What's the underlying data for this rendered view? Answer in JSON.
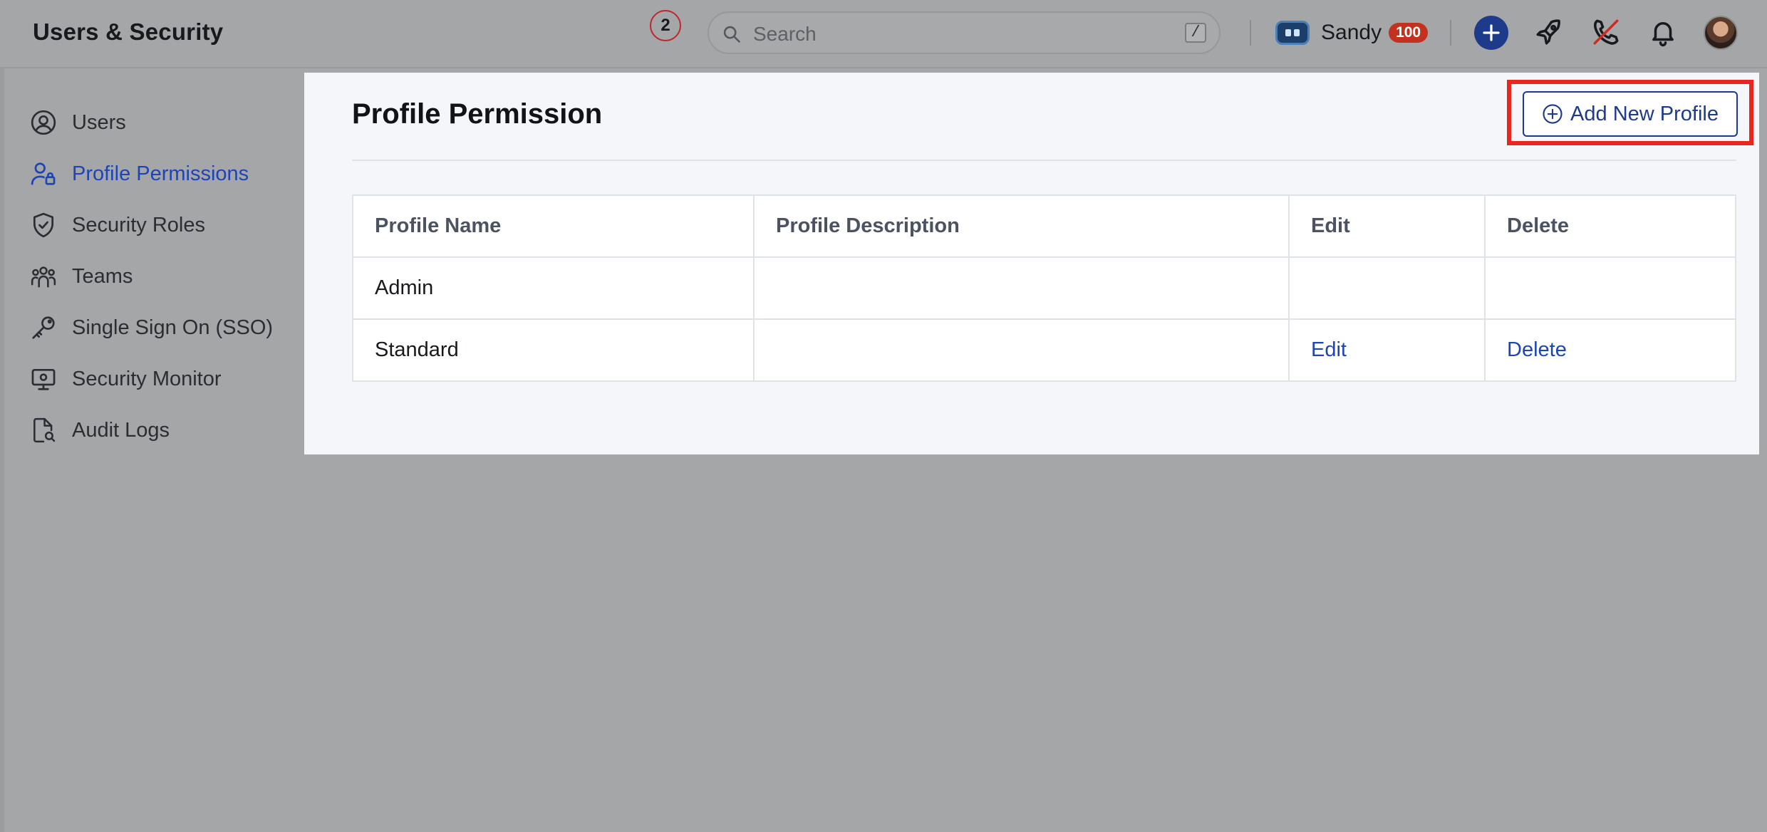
{
  "header": {
    "app_title": "Users & Security",
    "step_badge": "2",
    "search": {
      "placeholder": "Search",
      "value": "",
      "shortcut_key": "/"
    },
    "user": {
      "name": "Sandy",
      "credits": "100"
    },
    "icons": [
      "plus-icon",
      "rocket-icon",
      "phone-off-icon",
      "bell-icon",
      "avatar"
    ]
  },
  "sidebar": {
    "items": [
      {
        "label": "Users",
        "icon": "user-circle-icon",
        "active": false
      },
      {
        "label": "Profile Permissions",
        "icon": "user-lock-icon",
        "active": true
      },
      {
        "label": "Security Roles",
        "icon": "shield-check-icon",
        "active": false
      },
      {
        "label": "Teams",
        "icon": "team-icon",
        "active": false
      },
      {
        "label": "Single Sign On (SSO)",
        "icon": "key-icon",
        "active": false
      },
      {
        "label": "Security Monitor",
        "icon": "monitor-icon",
        "active": false
      },
      {
        "label": "Audit Logs",
        "icon": "document-search-icon",
        "active": false
      }
    ]
  },
  "main": {
    "title": "Profile Permission",
    "add_button_label": "Add New Profile",
    "table": {
      "columns": [
        "Profile Name",
        "Profile Description",
        "Edit",
        "Delete"
      ],
      "rows": [
        {
          "name": "Admin",
          "description": "",
          "edit": "",
          "delete": ""
        },
        {
          "name": "Standard",
          "description": "",
          "edit": "Edit",
          "delete": "Delete"
        }
      ]
    }
  },
  "colors": {
    "accent": "#1d45b5",
    "primary_dark": "#1e3a8a",
    "badge_red": "#c4321f",
    "highlight_red": "#e8261d"
  }
}
